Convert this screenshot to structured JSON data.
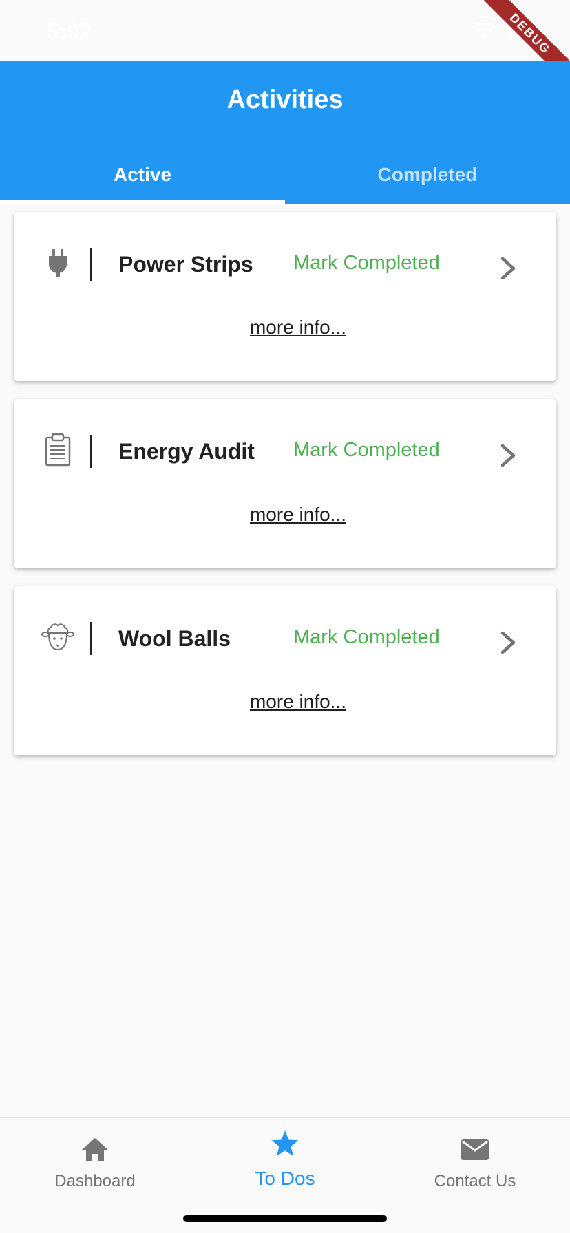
{
  "status_bar": {
    "time": "5:02",
    "debug_label": "DEBUG"
  },
  "app_bar": {
    "title": "Activities",
    "tabs": [
      {
        "label": "Active",
        "selected": true
      },
      {
        "label": "Completed",
        "selected": false
      }
    ]
  },
  "activities": [
    {
      "icon": "plug-icon",
      "title": "Power Strips",
      "action": "Mark Completed",
      "more": "more info..."
    },
    {
      "icon": "clipboard-icon",
      "title": "Energy Audit",
      "action": "Mark Completed",
      "more": "more info..."
    },
    {
      "icon": "sheep-icon",
      "title": "Wool Balls",
      "action": "Mark Completed",
      "more": "more info..."
    }
  ],
  "bottom_nav": {
    "items": [
      {
        "label": "Dashboard",
        "icon": "home-icon",
        "selected": false
      },
      {
        "label": "To Dos",
        "icon": "star-icon",
        "selected": true
      },
      {
        "label": "Contact Us",
        "icon": "mail-icon",
        "selected": false
      }
    ]
  },
  "colors": {
    "primary": "#2196f3",
    "action_green": "#4caf50",
    "text_dark": "#222222",
    "nav_inactive": "#757575"
  }
}
